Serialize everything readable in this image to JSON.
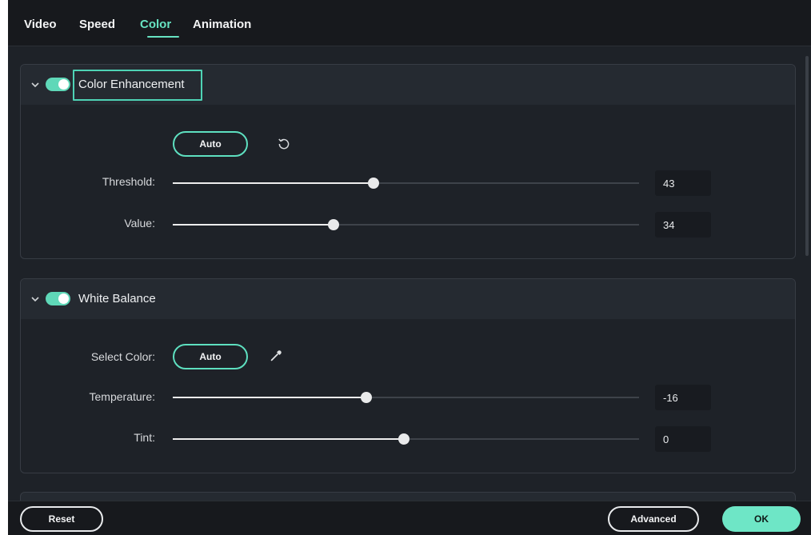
{
  "tabs": [
    {
      "label": "Video"
    },
    {
      "label": "Speed"
    },
    {
      "label": "Color"
    },
    {
      "label": "Animation"
    }
  ],
  "active_tab": "Color",
  "color_enhancement": {
    "title": "Color Enhancement",
    "enabled": true,
    "auto_label": "Auto",
    "reset_icon": "reset-icon",
    "threshold": {
      "label": "Threshold:",
      "value": "43",
      "fraction": 0.43
    },
    "value": {
      "label": "Value:",
      "value": "34",
      "fraction": 0.34
    }
  },
  "white_balance": {
    "title": "White Balance",
    "enabled": true,
    "select_color_label": "Select Color:",
    "auto_label": "Auto",
    "picker_icon": "eyedropper-icon",
    "temperature": {
      "label": "Temperature:",
      "value": "-16",
      "fraction": 0.42
    },
    "tint": {
      "label": "Tint:",
      "value": "0",
      "fraction": 0.5
    }
  },
  "footer": {
    "reset_label": "Reset",
    "advanced_label": "Advanced",
    "ok_label": "OK"
  },
  "colors": {
    "accent": "#67e3c2",
    "background": "#1e2228",
    "header": "#17191d"
  }
}
